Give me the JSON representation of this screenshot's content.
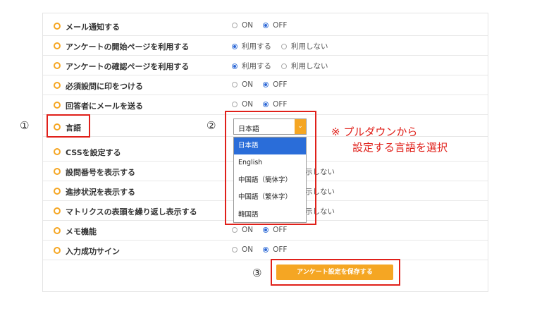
{
  "rows": [
    {
      "label": "メール通知する",
      "options": [
        {
          "text": "ON",
          "selected": false
        },
        {
          "text": "OFF",
          "selected": true
        }
      ]
    },
    {
      "label": "アンケートの開始ページを利用する",
      "options": [
        {
          "text": "利用する",
          "selected": true
        },
        {
          "text": "利用しない",
          "selected": false
        }
      ]
    },
    {
      "label": "アンケートの確認ページを利用する",
      "options": [
        {
          "text": "利用する",
          "selected": true
        },
        {
          "text": "利用しない",
          "selected": false
        }
      ]
    },
    {
      "label": "必須設問に印をつける",
      "options": [
        {
          "text": "ON",
          "selected": false
        },
        {
          "text": "OFF",
          "selected": true
        }
      ]
    },
    {
      "label": "回答者にメールを送る",
      "options": [
        {
          "text": "ON",
          "selected": false
        },
        {
          "text": "OFF",
          "selected": true
        }
      ]
    },
    {
      "label": "言語",
      "options": []
    },
    {
      "label": "CSSを設定する",
      "options": []
    },
    {
      "label": "設問番号を表示する",
      "options": [
        {
          "text": "示しない",
          "selected": false
        }
      ]
    },
    {
      "label": "進捗状況を表示する",
      "options": [
        {
          "text": "示しない",
          "selected": false
        }
      ]
    },
    {
      "label": "マトリクスの表頭を繰り返し表示する",
      "options": [
        {
          "text": "示しない",
          "selected": false
        }
      ]
    },
    {
      "label": "メモ機能",
      "options": [
        {
          "text": "ON",
          "selected": false
        },
        {
          "text": "OFF",
          "selected": true
        }
      ]
    },
    {
      "label": "入力成功サイン",
      "options": [
        {
          "text": "ON",
          "selected": false
        },
        {
          "text": "OFF",
          "selected": true
        }
      ]
    }
  ],
  "language_select": {
    "value": "日本語",
    "arrow": "⌄",
    "options": [
      "日本語",
      "English",
      "中国語（簡体字）",
      "中国語（繁体字）",
      "韓国語"
    ]
  },
  "annotations": {
    "n1": "①",
    "n2": "②",
    "n3": "③",
    "note_line1": "※ プルダウンから",
    "note_line2": "　　設定する言語を選択"
  },
  "save_label": "アンケート設定を保存する",
  "colors": {
    "accent": "#f5a623",
    "highlight": "#e0201a",
    "selected": "#2a6dd9"
  }
}
